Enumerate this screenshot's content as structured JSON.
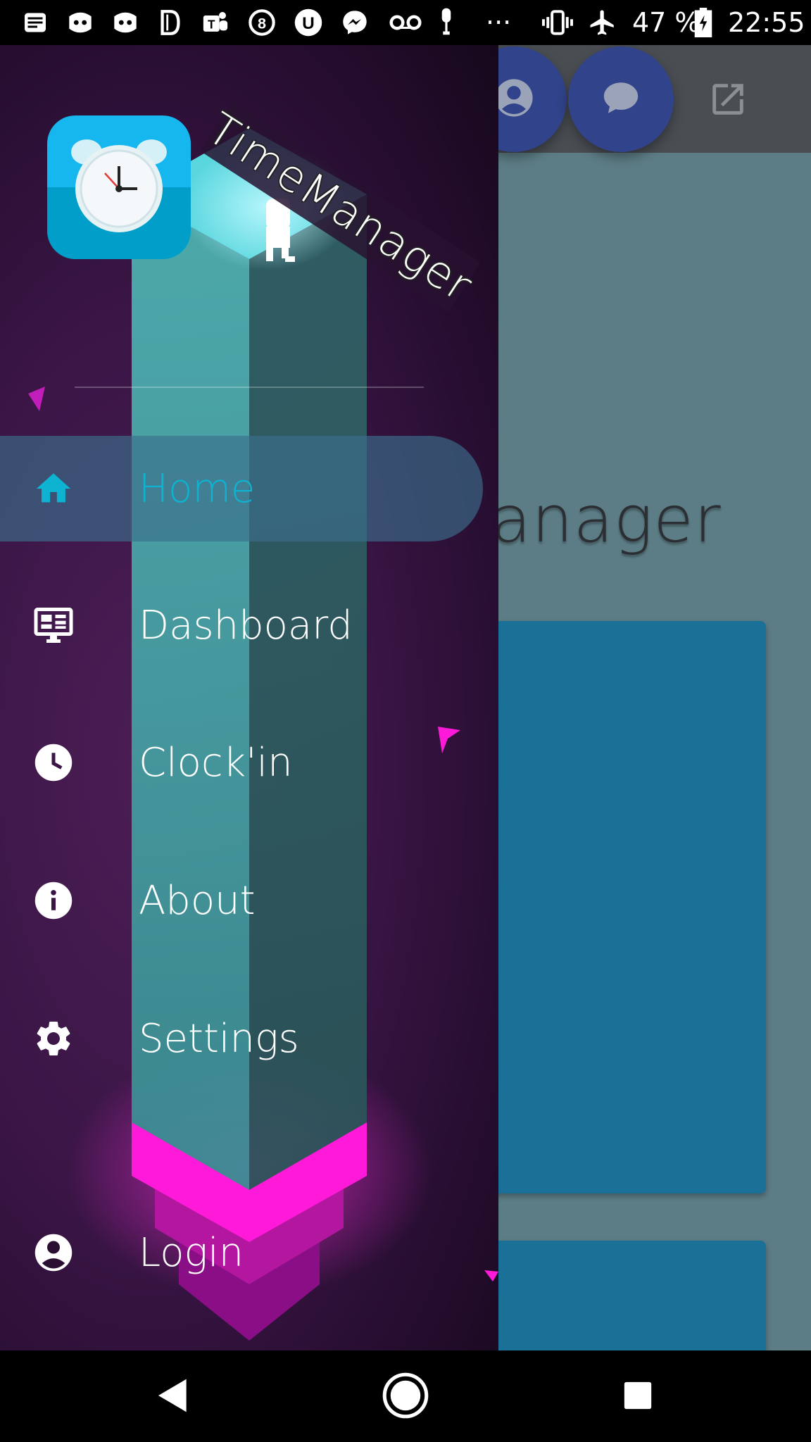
{
  "status_bar": {
    "battery": "47 %",
    "time": "22:55",
    "overflow": "···",
    "notification_icons": [
      "notes-icon",
      "discord-icon",
      "discord-icon",
      "dm-icon",
      "teams-icon",
      "app-8-icon",
      "u-icon",
      "messenger-icon",
      "voicemail-icon",
      "usb-icon"
    ],
    "system_icons": [
      "vibrate-icon",
      "airplane-icon",
      "battery-icon"
    ]
  },
  "app": {
    "title_visible": "eManager",
    "toolbar_icons": [
      "account-icon",
      "chat-icon",
      "open-external-icon"
    ],
    "colors": {
      "background": "#5d7d86",
      "toolbar": "#4a4e53",
      "fab": "#31438a",
      "card": "#1b7097"
    }
  },
  "drawer": {
    "banner": "TimeManager",
    "logo_icon": "alarm-clock-icon",
    "items": [
      {
        "label": "Home",
        "icon": "home-icon",
        "active": true
      },
      {
        "label": "Dashboard",
        "icon": "dashboard-icon",
        "active": false
      },
      {
        "label": "Clock'in",
        "icon": "clock-icon",
        "active": false
      },
      {
        "label": "About",
        "icon": "info-icon",
        "active": false
      },
      {
        "label": "Settings",
        "icon": "settings-icon",
        "active": false
      },
      {
        "label": "Login",
        "icon": "account-circle-icon",
        "active": false
      }
    ],
    "colors": {
      "active_text": "#0db3d0",
      "pillar": "#3aa7a8",
      "base": "#ff19d9"
    }
  },
  "nav_bar": {
    "buttons": [
      "back-icon",
      "home-circle-icon",
      "recents-icon"
    ]
  }
}
